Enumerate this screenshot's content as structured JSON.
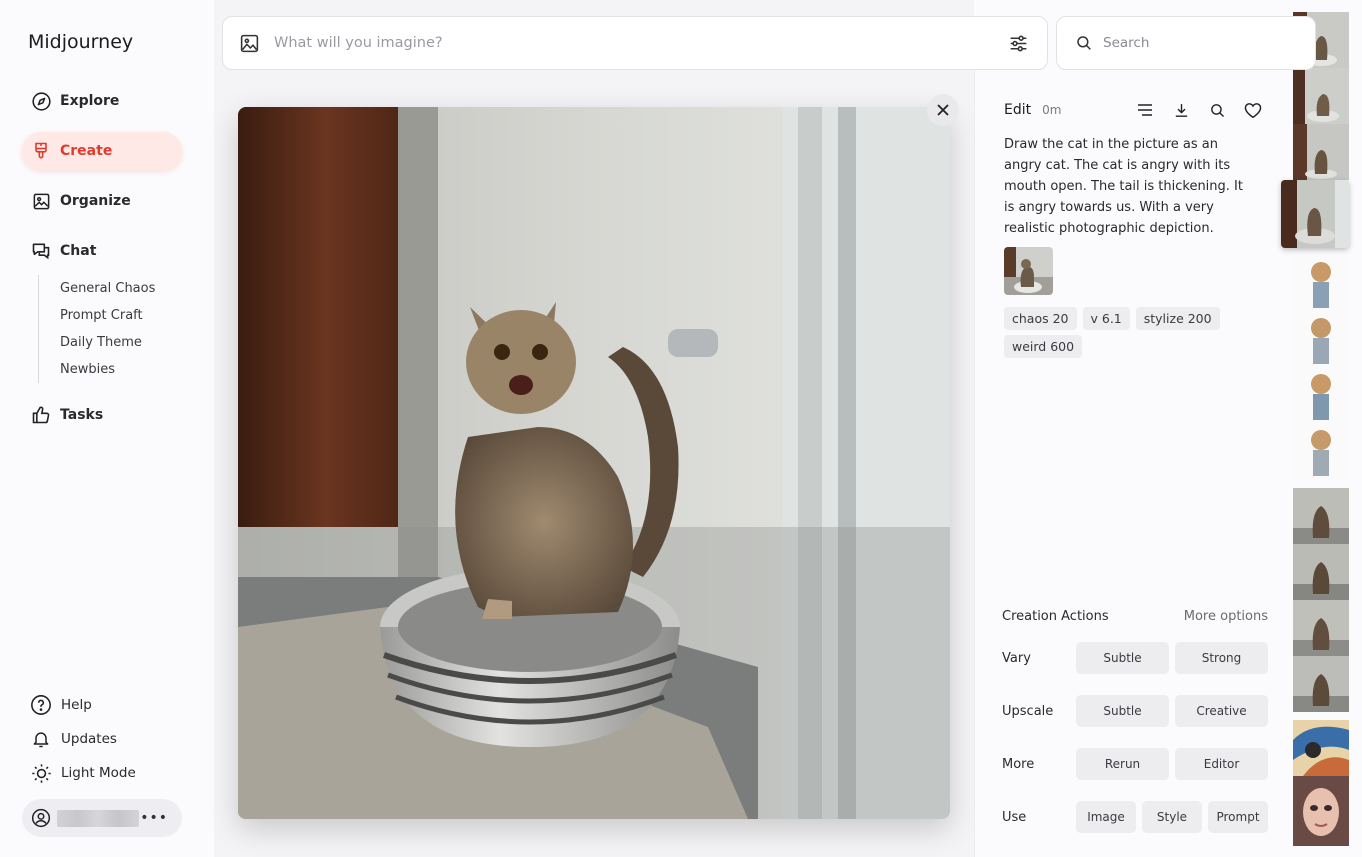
{
  "app": {
    "title": "Midjourney"
  },
  "nav": {
    "explore": "Explore",
    "create": "Create",
    "organize": "Organize",
    "chat": "Chat",
    "chat_items": [
      "General Chaos",
      "Prompt Craft",
      "Daily Theme",
      "Newbies"
    ],
    "tasks": "Tasks"
  },
  "bottom": {
    "help": "Help",
    "updates": "Updates",
    "light_mode": "Light Mode"
  },
  "prompt": {
    "placeholder": "What will you imagine?"
  },
  "search": {
    "placeholder": "Search"
  },
  "details": {
    "edit_label": "Edit",
    "time": "0m",
    "prompt_text": "Draw the cat in the picture as an angry cat. The cat is angry with its mouth open. The tail is thickening. It is angry towards us. With a very realistic photographic depiction.",
    "params": [
      "chaos 20",
      "v 6.1",
      "stylize 200",
      "weird 600"
    ]
  },
  "creation_actions": {
    "title": "Creation Actions",
    "more_options": "More options",
    "rows": [
      {
        "label": "Vary",
        "buttons": [
          "Subtle",
          "Strong"
        ]
      },
      {
        "label": "Upscale",
        "buttons": [
          "Subtle",
          "Creative"
        ]
      },
      {
        "label": "More",
        "buttons": [
          "Rerun",
          "Editor"
        ]
      },
      {
        "label": "Use",
        "buttons": [
          "Image",
          "Style",
          "Prompt"
        ]
      }
    ]
  },
  "colors": {
    "accent": "#e23b2e",
    "accent_bg": "#ffe9e6"
  }
}
